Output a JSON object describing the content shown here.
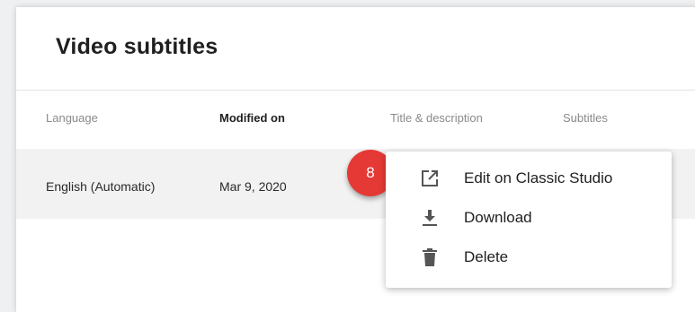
{
  "panel": {
    "title": "Video subtitles"
  },
  "table": {
    "headers": {
      "language": "Language",
      "modified_on": "Modified on",
      "title_description": "Title & description",
      "subtitles": "Subtitles"
    },
    "rows": [
      {
        "language": "English (Automatic)",
        "modified_on": "Mar 9, 2020"
      }
    ]
  },
  "step_badge": {
    "number": "8",
    "color": "#e53935"
  },
  "menu": {
    "items": [
      {
        "label": "Edit on Classic Studio",
        "icon": "open-in-new-icon"
      },
      {
        "label": "Download",
        "icon": "download-icon"
      },
      {
        "label": "Delete",
        "icon": "trash-icon"
      }
    ]
  }
}
